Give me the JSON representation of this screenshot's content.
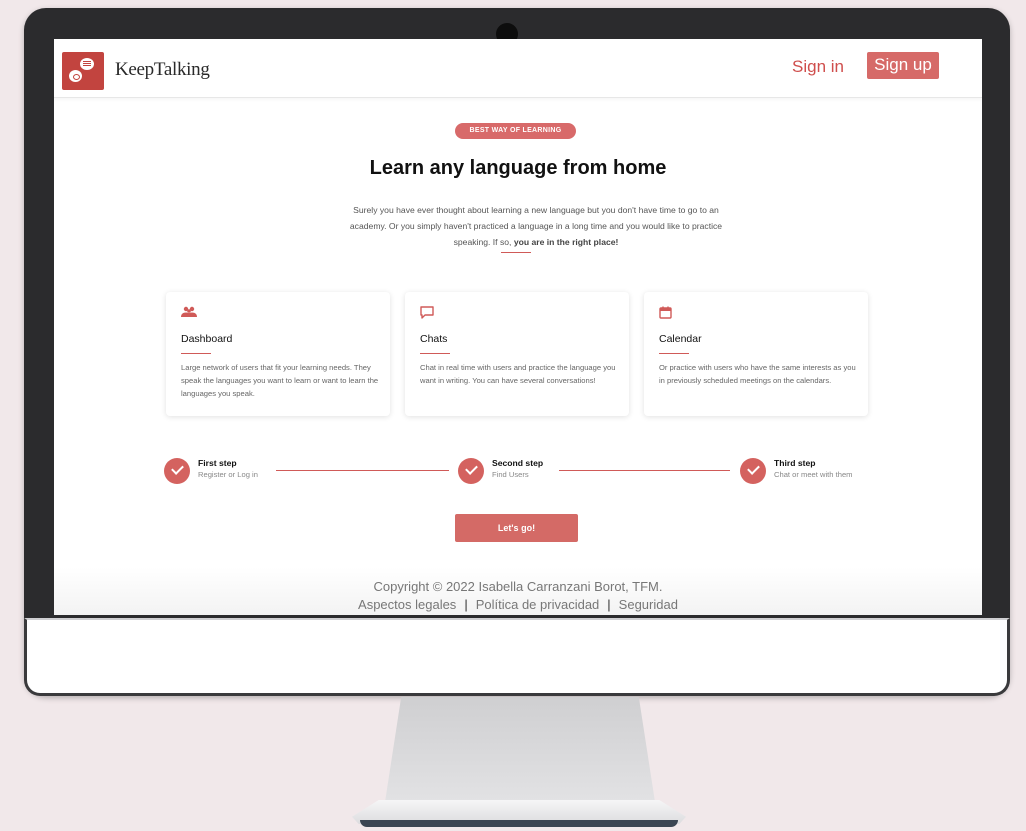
{
  "nav": {
    "brand": "KeepTalking",
    "signin_label": "Sign in",
    "signup_label": "Sign up"
  },
  "hero": {
    "badge": "BEST WAY OF LEARNING",
    "title": "Learn any language from home",
    "text": "Surely you have ever thought about learning a new language but you don't have time to go to an academy. Or you simply haven't practiced a language in a long time and you would like to practice speaking. If so,",
    "text_bold": "you are in the right place!"
  },
  "features": [
    {
      "icon": "users-icon",
      "title": "Dashboard",
      "body": "Large network of users that fit your learning needs. They speak the languages you want to learn or want to learn the languages you speak."
    },
    {
      "icon": "chat-icon",
      "title": "Chats",
      "body": "Chat in real time with users and practice the language you want in writing. You can have several conversations!"
    },
    {
      "icon": "calendar-icon",
      "title": "Calendar",
      "body": "Or practice with users who have the same interests as you in previously scheduled meetings on the calendars."
    }
  ],
  "steps": [
    {
      "title": "First step",
      "subtitle": "Register or Log in"
    },
    {
      "title": "Second step",
      "subtitle": "Find Users"
    },
    {
      "title": "Third step",
      "subtitle": "Chat or meet with them"
    }
  ],
  "cta_label": "Let's go!",
  "footer": {
    "copyright": "Copyright © 2022 Isabella Carranzani Borot, TFM.",
    "links": [
      "Aspectos legales",
      "Política de privacidad",
      "Seguridad"
    ],
    "separator": "|"
  },
  "colors": {
    "accent": "#d05a58",
    "background": "#f1e8ea",
    "bezel": "#2b2b2d"
  }
}
